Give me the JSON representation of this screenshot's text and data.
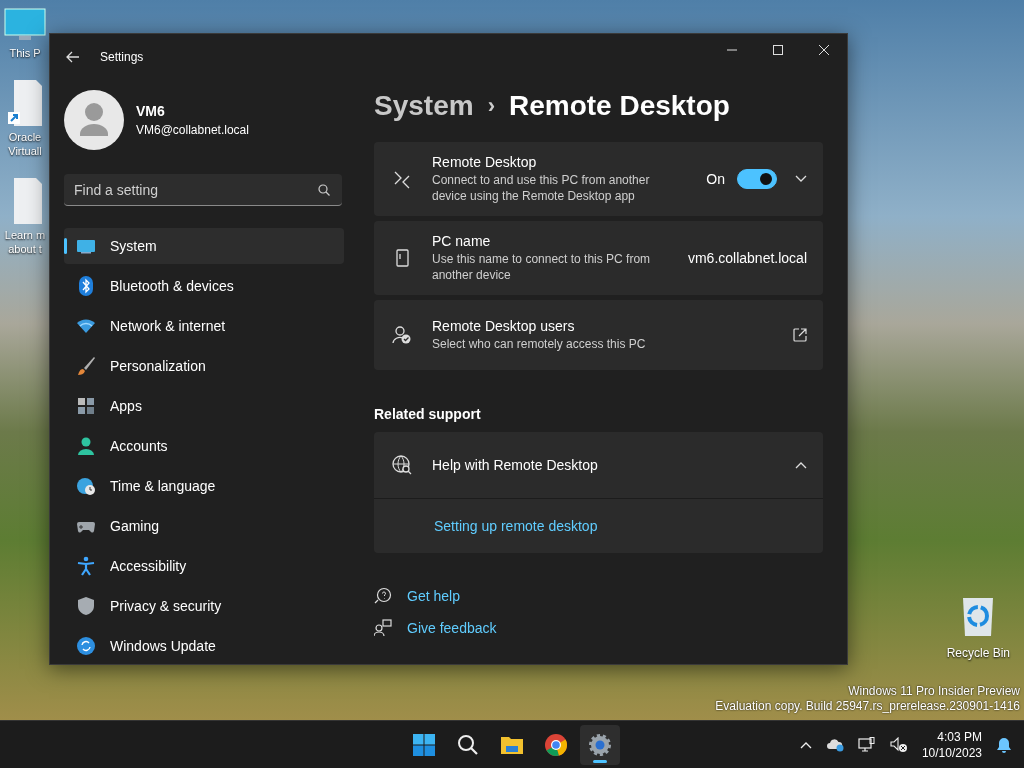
{
  "desktop": {
    "icons": [
      {
        "kind": "monitor",
        "lines": [
          "This P"
        ]
      },
      {
        "kind": "shortcut",
        "lines": [
          "Oracle",
          "Virtuall"
        ]
      },
      {
        "kind": "document",
        "lines": [
          "Learn m",
          "about t"
        ]
      }
    ],
    "recycle_bin": {
      "label": "Recycle Bin"
    },
    "watermark": [
      "Windows 11 Pro Insider Preview",
      "Evaluation copy. Build 25947.rs_prerelease.230901-1416"
    ]
  },
  "window": {
    "title": "Settings"
  },
  "account": {
    "name": "VM6",
    "email": "VM6@collabnet.local"
  },
  "search": {
    "placeholder": "Find a setting"
  },
  "nav": [
    {
      "label": "System",
      "selected": true
    },
    {
      "label": "Bluetooth & devices",
      "selected": false
    },
    {
      "label": "Network & internet",
      "selected": false
    },
    {
      "label": "Personalization",
      "selected": false
    },
    {
      "label": "Apps",
      "selected": false
    },
    {
      "label": "Accounts",
      "selected": false
    },
    {
      "label": "Time & language",
      "selected": false
    },
    {
      "label": "Gaming",
      "selected": false
    },
    {
      "label": "Accessibility",
      "selected": false
    },
    {
      "label": "Privacy & security",
      "selected": false
    },
    {
      "label": "Windows Update",
      "selected": false
    }
  ],
  "breadcrumb": {
    "parent": "System",
    "separator": "›",
    "current": "Remote Desktop"
  },
  "cards": [
    {
      "kind": "toggle",
      "title": "Remote Desktop",
      "description": "Connect to and use this PC from another device using the Remote Desktop app",
      "state_label": "On",
      "on": true,
      "expanded": false
    },
    {
      "kind": "value",
      "title": "PC name",
      "description": "Use this name to connect to this PC from another device",
      "value": "vm6.collabnet.local"
    },
    {
      "kind": "link",
      "title": "Remote Desktop users",
      "description": "Select who can remotely access this PC"
    }
  ],
  "related": {
    "heading": "Related support",
    "title": "Help with Remote Desktop",
    "expanded": true,
    "links": [
      "Setting up remote desktop"
    ]
  },
  "footer_links": [
    {
      "kind": "help",
      "label": "Get help"
    },
    {
      "kind": "feedback",
      "label": "Give feedback"
    }
  ],
  "taskbar": {
    "apps": [
      {
        "kind": "start",
        "selected": false
      },
      {
        "kind": "search",
        "selected": false
      },
      {
        "kind": "folder",
        "selected": false
      },
      {
        "kind": "browser",
        "selected": false
      },
      {
        "kind": "settings",
        "selected": true
      }
    ],
    "clock": {
      "time": "4:03 PM",
      "date": "10/10/2023"
    }
  }
}
